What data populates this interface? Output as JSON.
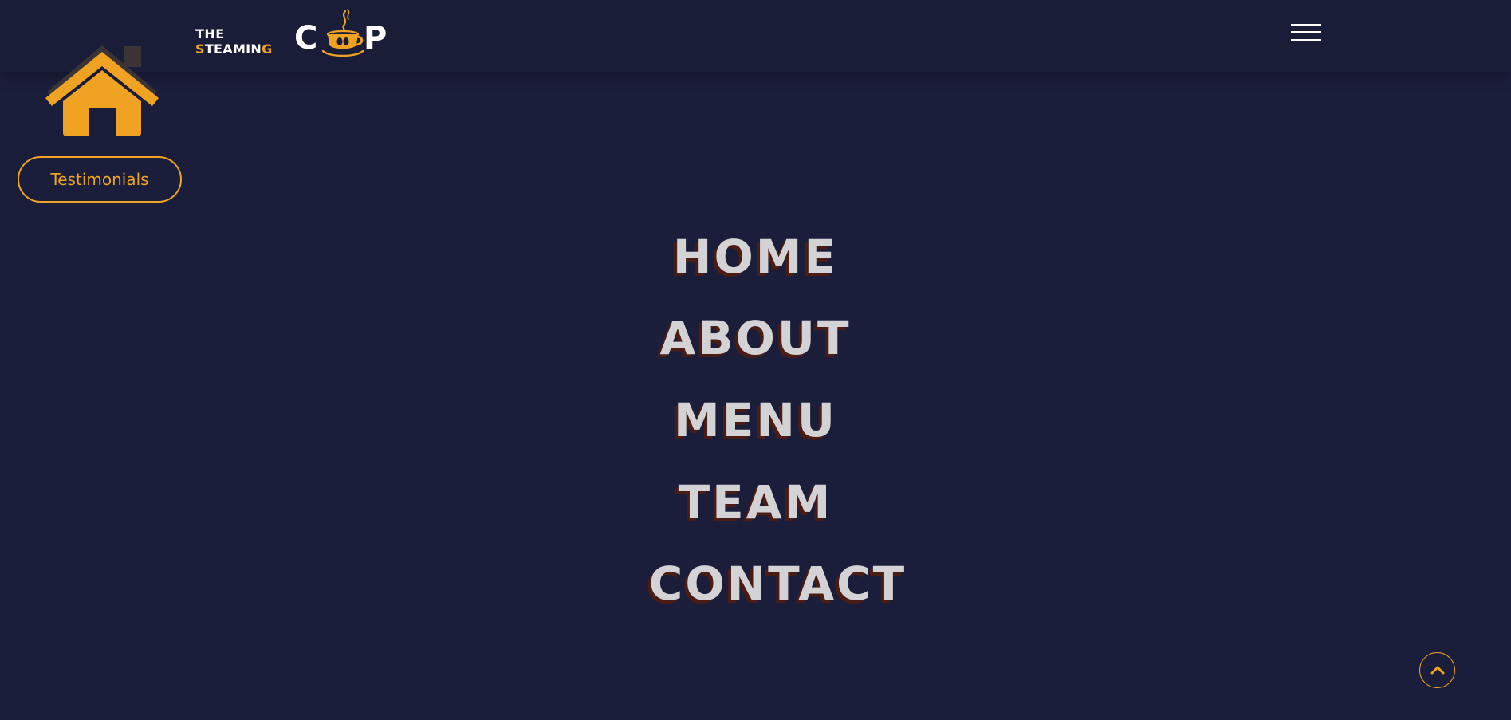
{
  "brand": {
    "word_the": "THE",
    "word_steaming_first": "S",
    "word_steaming_middle": "TEAMIN",
    "word_steaming_last": "G",
    "word_cup_c": "C",
    "word_cup_p": "P",
    "logo_icon": "coffee-cup-icon"
  },
  "header": {
    "menu_icon": "hamburger-icon"
  },
  "sidebar": {
    "home_icon": "house-icon",
    "testimonials_label": "Testimonials"
  },
  "nav": {
    "items": [
      {
        "label": "HOME"
      },
      {
        "label": "ABOUT"
      },
      {
        "label": "MENU"
      },
      {
        "label": "TEAM"
      },
      {
        "label": "CONTACT"
      }
    ]
  },
  "scroll_top": {
    "icon": "chevron-up-icon"
  },
  "colors": {
    "background": "#1b1e3b",
    "accent": "#f0a322",
    "nav_text": "#d3d3d6",
    "nav_shadow": "#4a1c14",
    "white": "#ffffff"
  }
}
